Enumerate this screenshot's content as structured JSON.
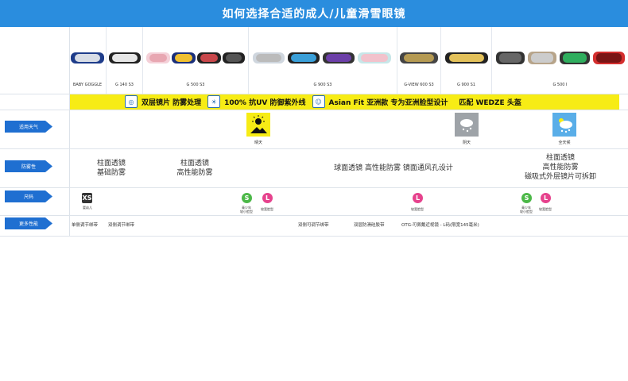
{
  "title": "如何选择合适的成人/儿童滑雪眼镜",
  "models": [
    "BABY GOGGLE",
    "G 140 S3",
    "G 500 S3",
    "G 900 S3",
    "G-VIEW 600 S3",
    "G 900 S1",
    "G 500 I"
  ],
  "band": {
    "items": [
      "双层镜片 防雾处理",
      "100% 抗UV 防御紫外线",
      "Asian Fit 亚洲款 专为亚洲脸型设计"
    ],
    "match": "匹配 WEDZE 头盔"
  },
  "rows": {
    "weather_label": "适用天气",
    "antifog_label": "防雾性",
    "size_label": "尺码",
    "features_label": "更多性能"
  },
  "weather": {
    "sunny": "晴天",
    "cloudy": "阴天",
    "all": "全天候"
  },
  "antifog": {
    "baby": "柱面透镜\n基础防雾",
    "g500": "柱面透镜\n高性能防雾",
    "g900": "球面透镜 高性能防雾 镜面通风孔设计",
    "g500i": "柱面透镜\n高性能防雾\n磁吸式外层镜片可拆卸"
  },
  "sizes": {
    "xs": "XS",
    "xs_cap": "婴幼儿",
    "s": "S",
    "s_cap": "青少年\n较小脸型",
    "l": "L",
    "l_cap": "较宽脸型"
  },
  "features": {
    "f1": "单侧调节绑带",
    "f2": "双侧调节绑带",
    "f3": "双侧可调节绑带",
    "f4": "双层防滑硅胶带",
    "f5": "OTG-可佩戴近视镜 - L码(限宽145毫米)"
  },
  "colors": {
    "banner": "#2a8dde",
    "label": "#1f6fd1",
    "yellow": "#f7ec15",
    "s_badge": "#4cb848",
    "l_badge": "#e6428d",
    "xs_badge": "#333333"
  }
}
